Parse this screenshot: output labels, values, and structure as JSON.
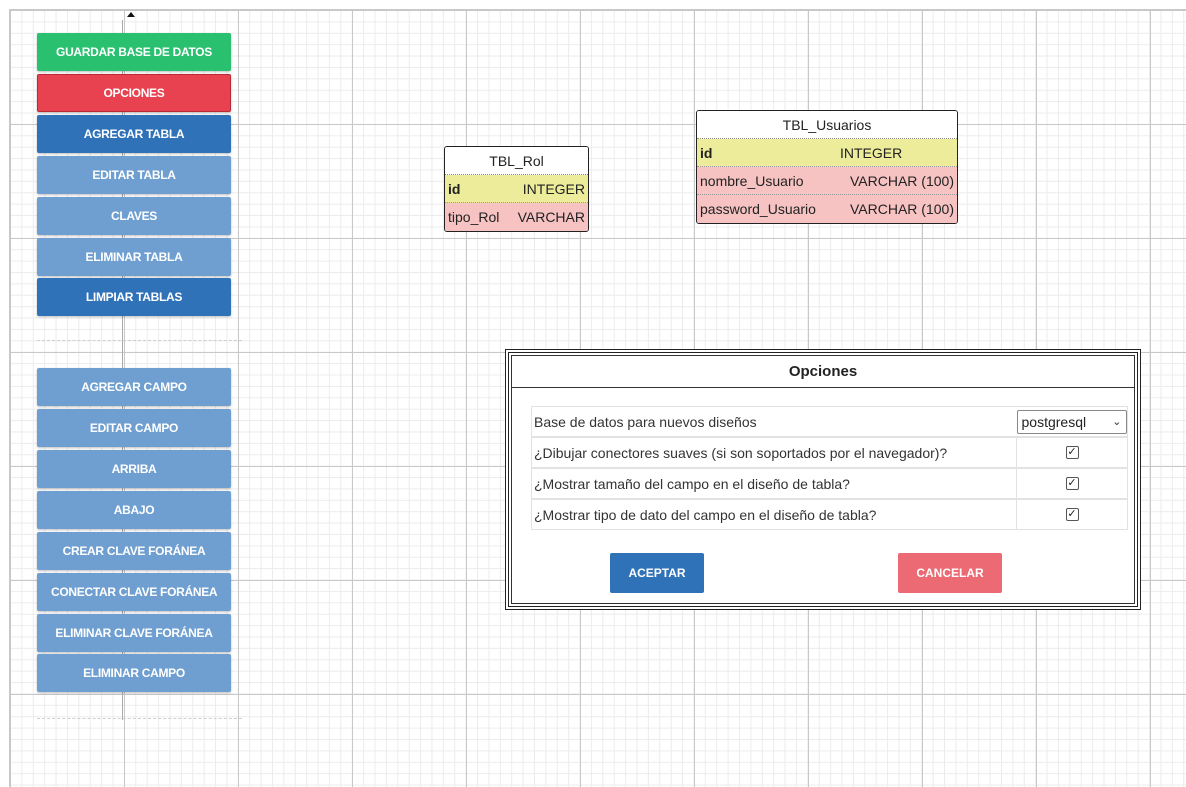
{
  "toolbar": {
    "buttons": [
      {
        "label": "GUARDAR BASE DE DATOS",
        "color": "#29c06f"
      },
      {
        "label": "OPCIONES",
        "color": "#e8414f"
      },
      {
        "label": "AGREGAR TABLA",
        "color": "#2f72b8"
      },
      {
        "label": "EDITAR TABLA",
        "color": "#6f9fd0"
      },
      {
        "label": "CLAVES",
        "color": "#6f9fd0"
      },
      {
        "label": "ELIMINAR TABLA",
        "color": "#6f9fd0"
      },
      {
        "label": "LIMPIAR TABLAS",
        "color": "#2f72b8"
      }
    ],
    "field_buttons": [
      {
        "label": "AGREGAR CAMPO"
      },
      {
        "label": "EDITAR CAMPO"
      },
      {
        "label": "ARRIBA"
      },
      {
        "label": "ABAJO"
      },
      {
        "label": "CREAR CLAVE FORÁNEA"
      },
      {
        "label": "CONECTAR CLAVE FORÁNEA"
      },
      {
        "label": "ELIMINAR CLAVE FORÁNEA"
      },
      {
        "label": "ELIMINAR CAMPO"
      }
    ]
  },
  "tables": {
    "rol": {
      "title": "TBL_Rol",
      "rows": [
        {
          "name": "id",
          "type": "INTEGER",
          "pk": true
        },
        {
          "name": "tipo_Rol",
          "type": "VARCHAR",
          "pk": false
        }
      ]
    },
    "usuarios": {
      "title": "TBL_Usuarios",
      "rows": [
        {
          "name": "id",
          "type": "INTEGER",
          "pk": true
        },
        {
          "name": "nombre_Usuario",
          "type": "VARCHAR (100)",
          "pk": false
        },
        {
          "name": "password_Usuario",
          "type": "VARCHAR (100)",
          "pk": false
        }
      ]
    }
  },
  "dialog": {
    "title": "Opciones",
    "options": [
      {
        "label": "Base de datos para nuevos diseños",
        "control": "select",
        "value": "postgresql"
      },
      {
        "label": "¿Dibujar conectores suaves (si son soportados por el navegador)?",
        "control": "checkbox",
        "checked": true
      },
      {
        "label": "¿Mostrar tamaño del campo en el diseño de tabla?",
        "control": "checkbox",
        "checked": true
      },
      {
        "label": "¿Mostrar tipo de dato del campo en el diseño de tabla?",
        "control": "checkbox",
        "checked": true
      }
    ],
    "accept_label": "ACEPTAR",
    "cancel_label": "CANCELAR"
  }
}
